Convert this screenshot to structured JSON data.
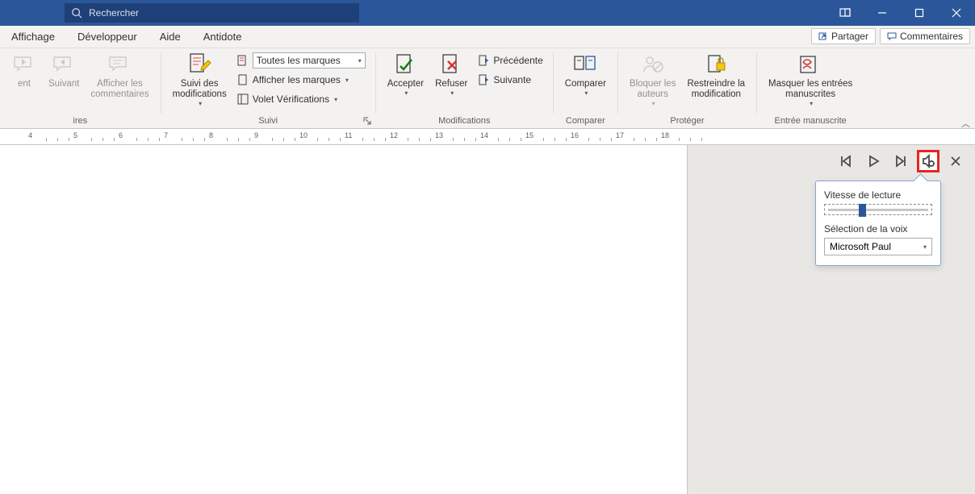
{
  "search": {
    "placeholder": "Rechercher"
  },
  "tabs": {
    "affichage": "Affichage",
    "developpeur": "Développeur",
    "aide": "Aide",
    "antidote": "Antidote"
  },
  "share": {
    "partager": "Partager",
    "commentaires": "Commentaires"
  },
  "ribbon": {
    "comments": {
      "prev": "ent",
      "next": "Suivant",
      "show": "Afficher les\ncommentaires",
      "group": "ires"
    },
    "suivi": {
      "track": "Suivi des\nmodifications",
      "markup_combo": "Toutes les marques",
      "show_markup": "Afficher les marques",
      "pane": "Volet Vérifications",
      "group": "Suivi"
    },
    "changes": {
      "accept": "Accepter",
      "reject": "Refuser",
      "prev": "Précédente",
      "next": "Suivante",
      "group": "Modifications"
    },
    "compare": {
      "btn": "Comparer",
      "group": "Comparer"
    },
    "protect": {
      "block": "Bloquer les\nauteurs",
      "restrict": "Restreindre la\nmodification",
      "group": "Protéger"
    },
    "ink": {
      "hide": "Masquer les entrées\nmanuscrites",
      "group": "Entrée manuscrite"
    }
  },
  "ruler": {
    "marks": [
      "4",
      "5",
      "6",
      "7",
      "8",
      "9",
      "10",
      "11",
      "12",
      "13",
      "14",
      "15",
      "16",
      "17",
      "18"
    ]
  },
  "popover": {
    "speed_label": "Vitesse de lecture",
    "voice_label": "Sélection de la voix",
    "voice_value": "Microsoft Paul"
  }
}
